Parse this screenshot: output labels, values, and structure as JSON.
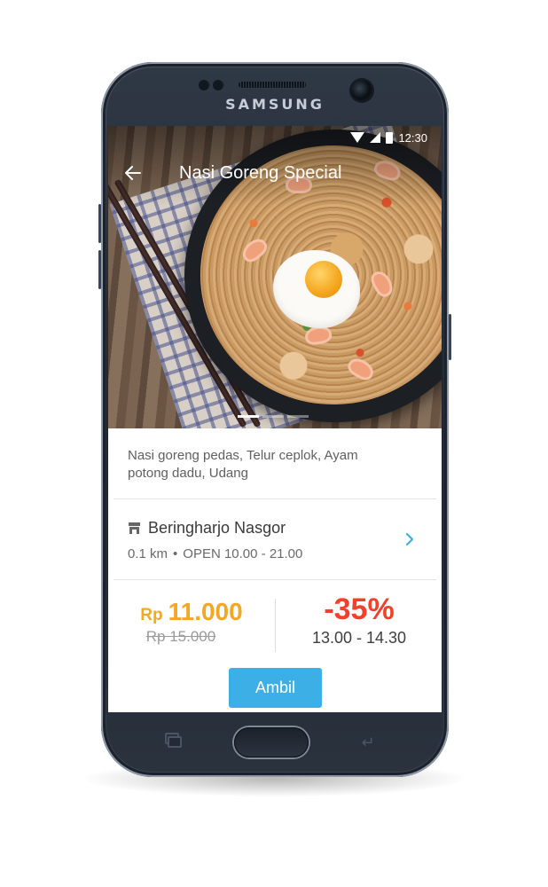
{
  "device": {
    "brand": "SAMSUNG"
  },
  "status_bar": {
    "time": "12:30"
  },
  "app_bar": {
    "title": "Nasi Goreng Special",
    "back_icon": "arrow-left-icon"
  },
  "carousel": {
    "total": 3,
    "active_index": 0
  },
  "product": {
    "description": "Nasi goreng pedas, Telur ceplok, Ayam potong dadu, Udang"
  },
  "store": {
    "icon": "store-icon",
    "name": "Beringharjo Nasgor",
    "distance": "0.1 km",
    "separator": "•",
    "hours": "OPEN 10.00 - 21.00",
    "chevron_icon": "chevron-right-icon"
  },
  "price": {
    "currency": "Rp",
    "value": "11.000",
    "original": "Rp 15.000"
  },
  "discount": {
    "percent": "-35%",
    "time_window": "13.00 - 14.30"
  },
  "actions": {
    "ambil_label": "Ambil"
  },
  "colors": {
    "accent": "#3cb0e6",
    "price": "#f5a623",
    "discount": "#f2402a",
    "chevron": "#3cb0e6"
  }
}
